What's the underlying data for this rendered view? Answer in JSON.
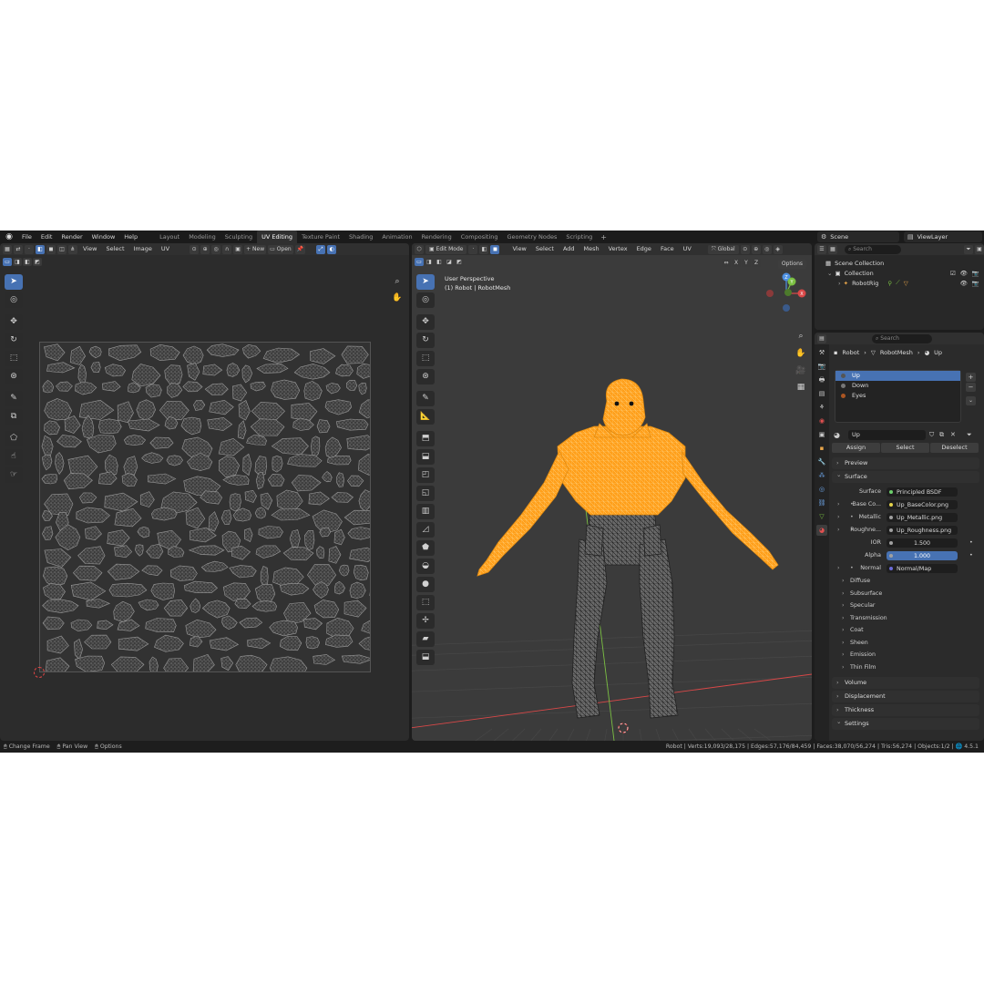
{
  "app": {
    "menus": [
      "File",
      "Edit",
      "Render",
      "Window",
      "Help"
    ],
    "workspaces": [
      "Layout",
      "Modeling",
      "Sculpting",
      "UV Editing",
      "Texture Paint",
      "Shading",
      "Animation",
      "Rendering",
      "Compositing",
      "Geometry Nodes",
      "Scripting"
    ],
    "active_workspace": "UV Editing",
    "scene": "Scene",
    "view_layer": "ViewLayer"
  },
  "uv_editor": {
    "menus": [
      "View",
      "Select",
      "Image",
      "UV"
    ],
    "new_label": "New",
    "open_label": "Open"
  },
  "viewport": {
    "mode": "Edit Mode",
    "menus": [
      "View",
      "Select",
      "Add",
      "Mesh",
      "Vertex",
      "Edge",
      "Face",
      "UV"
    ],
    "orientation": "Global",
    "options_label": "Options",
    "axes": [
      "X",
      "Y",
      "Z"
    ],
    "info_line1": "User Perspective",
    "info_line2": "(1) Robot | RobotMesh",
    "gizmo_labels": [
      "Z",
      "Y",
      "X"
    ]
  },
  "outliner": {
    "search_placeholder": "Search",
    "scene_collection": "Scene Collection",
    "collection": "Collection",
    "object": "RobotRig"
  },
  "properties": {
    "search_placeholder": "Search",
    "breadcrumb": [
      "Robot",
      "RobotMesh",
      "Up"
    ],
    "materials": [
      "Up",
      "Down",
      "Eyes"
    ],
    "material_name": "Up",
    "assign": "Assign",
    "select": "Select",
    "deselect": "Deselect",
    "panels": {
      "preview": "Preview",
      "surface": "Surface",
      "volume": "Volume",
      "displacement": "Displacement",
      "thickness": "Thickness",
      "settings": "Settings"
    },
    "surface_rows": [
      {
        "label": "Surface",
        "value": "Principled BSDF"
      },
      {
        "label": "Base Co...",
        "value": "Up_BaseColor.png"
      },
      {
        "label": "Metallic",
        "value": "Up_Metallic.png"
      },
      {
        "label": "Roughne...",
        "value": "Up_Roughness.png"
      },
      {
        "label": "IOR",
        "value": "1.500"
      },
      {
        "label": "Alpha",
        "value": "1.000"
      },
      {
        "label": "Normal",
        "value": "Normal/Map"
      }
    ],
    "subpanels": [
      "Diffuse",
      "Subsurface",
      "Specular",
      "Transmission",
      "Coat",
      "Sheen",
      "Emission",
      "Thin Film"
    ]
  },
  "status": {
    "hints": [
      "Change Frame",
      "Pan View",
      "Options"
    ],
    "stats": "Robot | Verts:19,093/28,175 | Edges:57,176/84,459 | Faces:38,070/56,274 | Tris:56,274 | Objects:1/2 | ",
    "version": "4.5.1"
  },
  "colors": {
    "accent": "#4772b3",
    "selected_mesh": "#ff9f1a",
    "mesh_wire": "#1a1a1a",
    "viewport_bg": "#3b3b3b",
    "x_axis": "#d94848",
    "y_axis": "#7bc043",
    "z_axis": "#4d8fe0"
  }
}
